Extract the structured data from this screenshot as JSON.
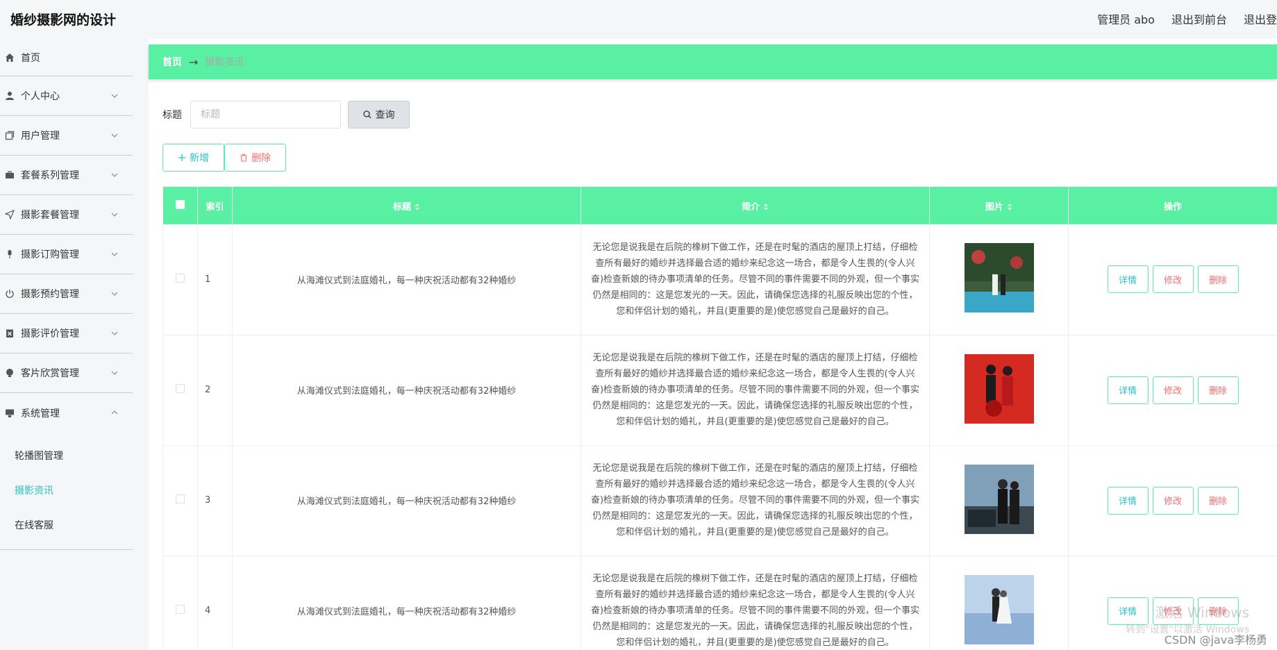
{
  "app": {
    "title": "婚纱摄影网的设计"
  },
  "header": {
    "admin": "管理员 abo",
    "to_front": "退出到前台",
    "logout": "退出登"
  },
  "sidebar": {
    "items": [
      {
        "label": "首页",
        "icon": "home-icon"
      },
      {
        "label": "个人中心",
        "icon": "user-icon"
      },
      {
        "label": "用户管理",
        "icon": "copy-icon"
      },
      {
        "label": "套餐系列管理",
        "icon": "briefcase-icon"
      },
      {
        "label": "摄影套餐管理",
        "icon": "send-icon"
      },
      {
        "label": "摄影订购管理",
        "icon": "microphone-icon"
      },
      {
        "label": "摄影预约管理",
        "icon": "power-icon"
      },
      {
        "label": "摄影评价管理",
        "icon": "delete-box-icon"
      },
      {
        "label": "客片欣赏管理",
        "icon": "bulb-icon"
      },
      {
        "label": "系统管理",
        "icon": "monitor-icon"
      }
    ],
    "sub_items": [
      {
        "label": "轮播图管理"
      },
      {
        "label": "摄影资讯"
      },
      {
        "label": "在线客服"
      }
    ]
  },
  "breadcrumb": {
    "home": "首页",
    "arrow": "→",
    "current": "摄影资讯"
  },
  "search": {
    "label": "标题",
    "placeholder": "标题",
    "button": "查询"
  },
  "actions": {
    "add": "新增",
    "delete": "删除"
  },
  "table": {
    "headers": {
      "index": "索引",
      "title": "标题",
      "intro": "简介",
      "image": "图片",
      "ops": "操作"
    },
    "rows": [
      {
        "index": "1",
        "title": "从海滩仪式到法庭婚礼，每一种庆祝活动都有32种婚纱",
        "intro": "无论您是说我是在后院的橡树下做工作，还是在时髦的酒店的屋顶上打结，仔细检查所有最好的婚纱并选择最合适的婚纱来纪念这一场合，都是令人生畏的(令人兴奋)检查新娘的待办事项清单的任务。尽管不同的事件需要不同的外观，但一个事实仍然是相同的：这是您发光的一天。因此，请确保您选择的礼服反映出您的个性，您和伴侣计划的婚礼，并且(更重要的是)使您感觉自己是最好的自己。"
      },
      {
        "index": "2",
        "title": "从海滩仪式到法庭婚礼，每一种庆祝活动都有32种婚纱",
        "intro": "无论您是说我是在后院的橡树下做工作，还是在时髦的酒店的屋顶上打结，仔细检查所有最好的婚纱并选择最合适的婚纱来纪念这一场合，都是令人生畏的(令人兴奋)检查新娘的待办事项清单的任务。尽管不同的事件需要不同的外观，但一个事实仍然是相同的：这是您发光的一天。因此，请确保您选择的礼服反映出您的个性，您和伴侣计划的婚礼，并且(更重要的是)使您感觉自己是最好的自己。"
      },
      {
        "index": "3",
        "title": "从海滩仪式到法庭婚礼，每一种庆祝活动都有32种婚纱",
        "intro": "无论您是说我是在后院的橡树下做工作，还是在时髦的酒店的屋顶上打结，仔细检查所有最好的婚纱并选择最合适的婚纱来纪念这一场合，都是令人生畏的(令人兴奋)检查新娘的待办事项清单的任务。尽管不同的事件需要不同的外观，但一个事实仍然是相同的：这是您发光的一天。因此，请确保您选择的礼服反映出您的个性，您和伴侣计划的婚礼，并且(更重要的是)使您感觉自己是最好的自己。"
      },
      {
        "index": "4",
        "title": "从海滩仪式到法庭婚礼，每一种庆祝活动都有32种婚纱",
        "intro": "无论您是说我是在后院的橡树下做工作，还是在时髦的酒店的屋顶上打结，仔细检查所有最好的婚纱并选择最合适的婚纱来纪念这一场合，都是令人生畏的(令人兴奋)检查新娘的待办事项清单的任务。尽管不同的事件需要不同的外观，但一个事实仍然是相同的：这是您发光的一天。因此，请确保您选择的礼服反映出您的个性，您和伴侣计划的婚礼，并且(更重要的是)使您感觉自己是最好的自己。"
      }
    ],
    "row_buttons": {
      "detail": "详情",
      "edit": "修改",
      "delete": "删除"
    }
  },
  "overlay": {
    "activate": "激活 Windows",
    "activate_hint": "转到\"设置\"以激活 Windows",
    "credit": "CSDN @java李杨勇"
  },
  "colors": {
    "accent": "#5af0a3",
    "teal": "#28c2c2",
    "danger": "#f56c6c"
  }
}
